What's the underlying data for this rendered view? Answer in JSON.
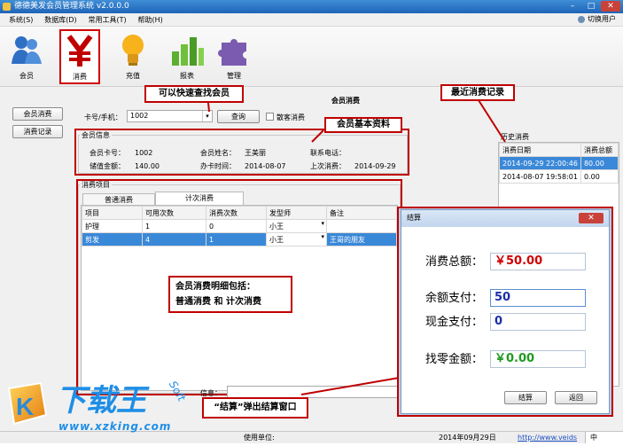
{
  "window": {
    "title": "德德美发会员管理系统 v2.0.0.0",
    "switch_user": "切换用户",
    "minimize": "–",
    "maximize": "□",
    "close": "✕"
  },
  "menu": [
    "系统(S)",
    "数据库(D)",
    "常用工具(T)",
    "帮助(H)"
  ],
  "toolbar": [
    {
      "label": "会员",
      "icon": "members-icon"
    },
    {
      "label": "消费",
      "icon": "yen-icon"
    },
    {
      "label": "充值",
      "icon": "lightbulb-icon"
    },
    {
      "label": "报表",
      "icon": "bar-chart-icon"
    },
    {
      "label": "管理",
      "icon": "puzzle-icon"
    }
  ],
  "sidebar": {
    "consume": "会员消费",
    "records": "消费记录"
  },
  "page_title": "会员消费",
  "search": {
    "label": "卡号/手机：",
    "value": "1002",
    "query_button": "查询",
    "walkin_label": "散客消费"
  },
  "member_info": {
    "legend": "会员信息",
    "card_label": "会员卡号：",
    "card": "1002",
    "name_label": "会员姓名：",
    "name": "王美丽",
    "phone_label": "联系电话：",
    "phone": "",
    "balance_label": "储值金额：",
    "balance": "140.00",
    "opened_label": "办卡时间：",
    "opened": "2014-08-07",
    "last_label": "上次消费：",
    "last": "2014-09-29"
  },
  "consume_items": {
    "legend": "消费项目",
    "tabs": [
      "普通消费",
      "计次消费"
    ],
    "columns": [
      "项目",
      "可用次数",
      "消费次数",
      "发型师",
      "备注"
    ],
    "rows": [
      [
        "护理",
        "1",
        "0",
        "小王",
        ""
      ],
      [
        "剪发",
        "4",
        "1",
        "小王",
        "王哥的朋友"
      ]
    ]
  },
  "history": {
    "legend": "历史消费",
    "columns": [
      "消费日期",
      "消费总额"
    ],
    "rows": [
      [
        "2014-09-29 22:00:46",
        "80.00"
      ],
      [
        "2014-08-07 19:58:01",
        "0.00"
      ]
    ]
  },
  "remark_label": "信息：",
  "callouts": {
    "quick_find": "可以快速查找会员",
    "member_profile": "会员基本资料",
    "recent": "最近消费记录",
    "detail": "会员消费明细包括：\n普通消费 和 计次消费",
    "popup": "“结算”弹出结算窗口"
  },
  "dialog": {
    "title": "结算",
    "total_label": "消费总额：",
    "total": "￥50.00",
    "balance_pay_label": "余额支付：",
    "balance_pay": "50",
    "cash_pay_label": "现金支付：",
    "cash_pay": "0",
    "change_label": "找零金额：",
    "change": "￥0.00",
    "settle_button": "结算",
    "back_button": "返回"
  },
  "statusbar": {
    "unit": "使用单位:",
    "date": "2014年09月29日",
    "link": "http://www.veids",
    "ime": "中"
  },
  "watermark": {
    "text": "下载王",
    "url": "www.xzking.com",
    "soft": "Soft"
  },
  "colors": {
    "accent_red": "#c00000",
    "title_blue": "#2a72c6",
    "selection_blue": "#3a88d8",
    "money_red": "#d00000",
    "money_green": "#1f9a1f",
    "money_blue": "#1a2fa8"
  }
}
